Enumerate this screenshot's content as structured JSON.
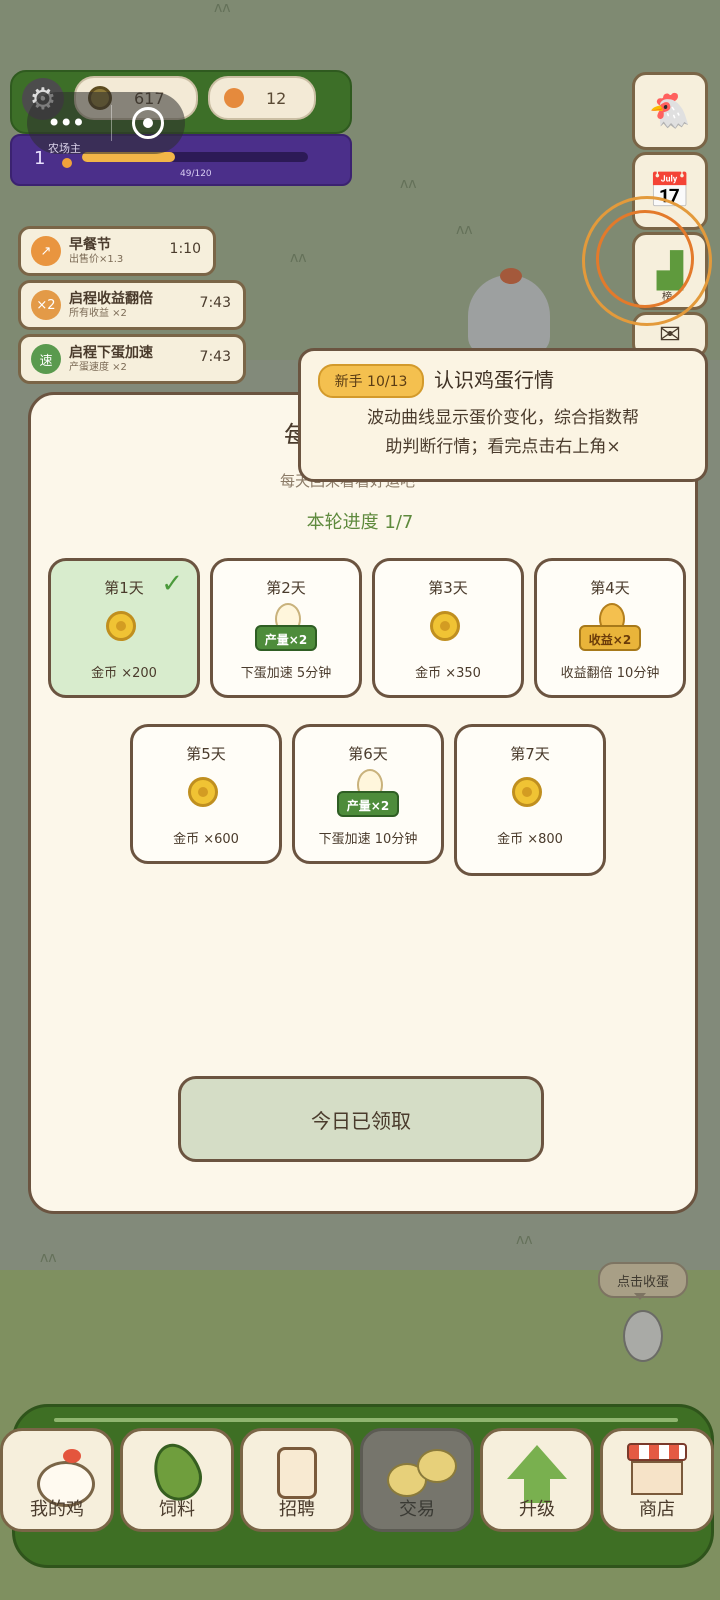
{
  "hud": {
    "coins": "617",
    "eggs": "12",
    "farmer_label": "农场主",
    "level": "1",
    "xp_text": "49/120",
    "xp_progress": 0.41
  },
  "buffs": [
    {
      "icon": "↗",
      "title": "早餐节",
      "subtitle": "出售价×1.3",
      "time": "1:10",
      "color": "#e9953f"
    },
    {
      "icon": "×2",
      "title": "启程收益翻倍",
      "subtitle": "所有收益 ×2",
      "time": "7:43",
      "color": "#e39a47"
    },
    {
      "icon": "速",
      "title": "启程下蛋加速",
      "subtitle": "产蛋速度 ×2",
      "time": "7:43",
      "color": "#5a9a4e"
    }
  ],
  "side": {
    "rank_label": "榜"
  },
  "tooltip": {
    "badge": "新手 10/13",
    "title": "认识鸡蛋行情",
    "line1": "波动曲线显示蛋价变化，综合指数帮",
    "line2": "助判断行情；看完点击右上角×"
  },
  "modal": {
    "title": "每",
    "subtitle": "每天回来看看好运吧",
    "progress": "本轮进度 1/7",
    "days": [
      {
        "label": "第1天",
        "reward": "金币 ×200",
        "sign": ""
      },
      {
        "label": "第2天",
        "reward": "下蛋加速 5分钟",
        "sign": "产量×2"
      },
      {
        "label": "第3天",
        "reward": "金币 ×350",
        "sign": ""
      },
      {
        "label": "第4天",
        "reward": "收益翻倍 10分钟",
        "sign": "收益×2"
      },
      {
        "label": "第5天",
        "reward": "金币 ×600",
        "sign": ""
      },
      {
        "label": "第6天",
        "reward": "下蛋加速 10分钟",
        "sign": "产量×2"
      },
      {
        "label": "第7天",
        "reward": "金币 ×800",
        "sign": ""
      }
    ],
    "claim_button": "今日已领取"
  },
  "egg_hint": "点击收蛋",
  "nav": [
    {
      "label": "我的鸡",
      "icon": "hen-icon"
    },
    {
      "label": "饲料",
      "icon": "leaf-icon"
    },
    {
      "label": "招聘",
      "icon": "id-badge-icon"
    },
    {
      "label": "交易",
      "icon": "chicks-trade-icon"
    },
    {
      "label": "升级",
      "icon": "upgrade-arrow-icon"
    },
    {
      "label": "商店",
      "icon": "shop-icon"
    }
  ]
}
